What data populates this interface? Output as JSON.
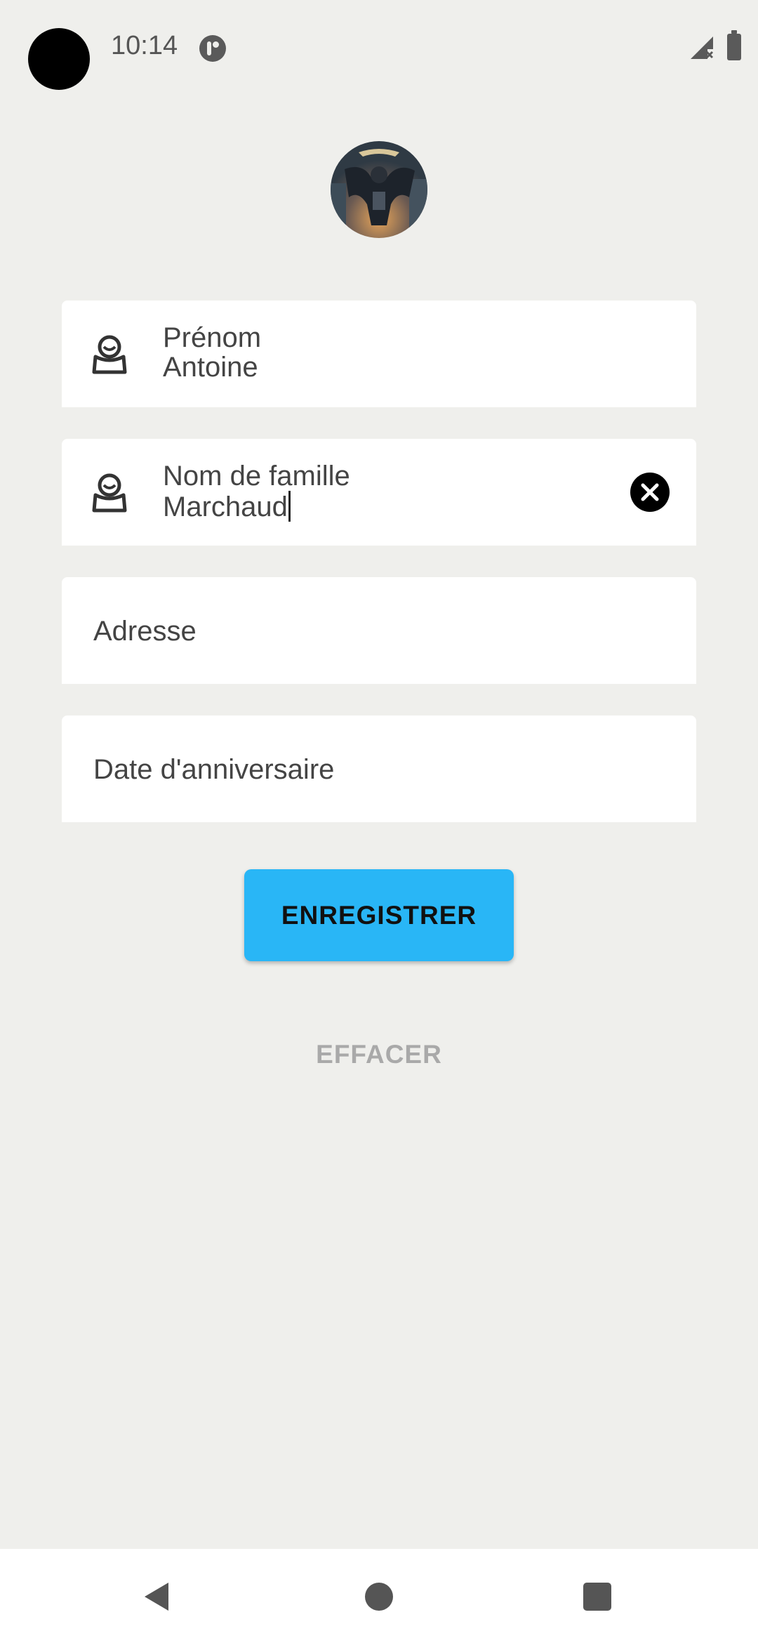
{
  "status_bar": {
    "time": "10:14"
  },
  "profile": {
    "avatar_icon": "bat-hero-avatar"
  },
  "form": {
    "first_name": {
      "label": "Prénom",
      "value": "Antoine",
      "icon": "person-icon"
    },
    "last_name": {
      "label": "Nom de famille",
      "value": "Marchaud",
      "icon": "person-icon",
      "clear_icon": "close-circle-icon"
    },
    "address": {
      "placeholder": "Adresse"
    },
    "birthday": {
      "placeholder": "Date d'anniversaire"
    }
  },
  "actions": {
    "save_label": "ENREGISTRER",
    "clear_label": "EFFACER"
  },
  "colors": {
    "background": "#efefec",
    "accent": "#29b6f6",
    "field_bg": "#ffffff",
    "muted_text": "#a9a9a9"
  }
}
